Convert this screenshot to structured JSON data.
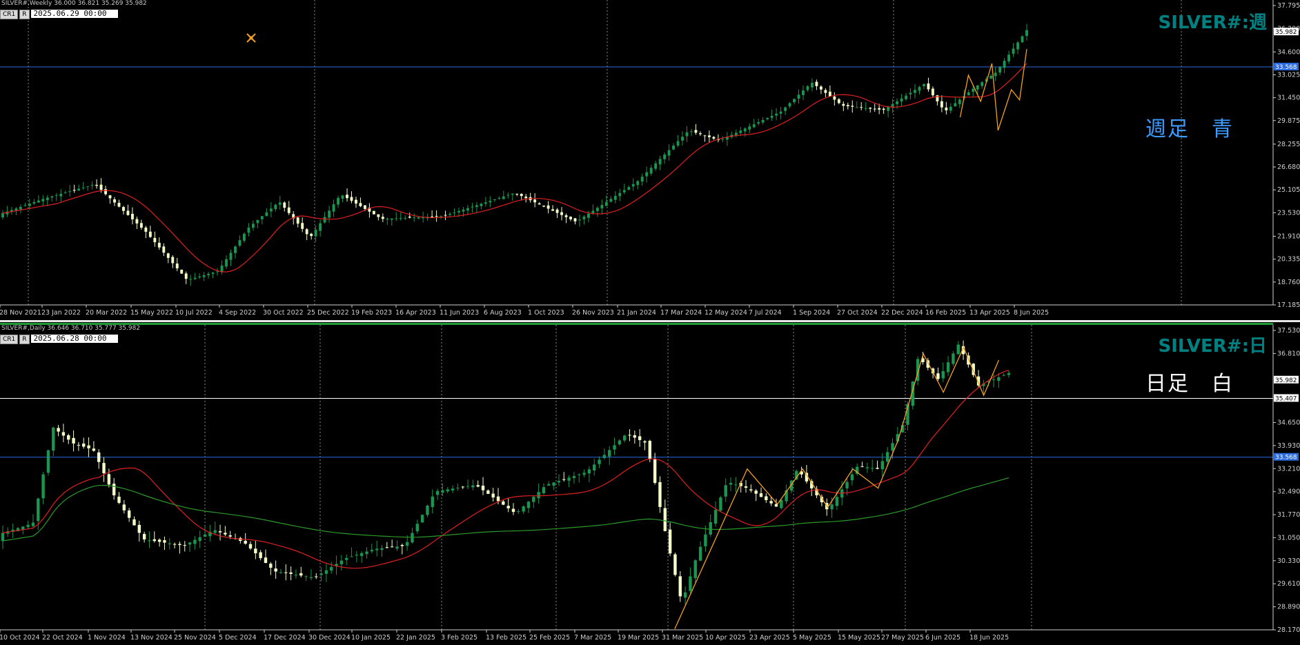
{
  "colors": {
    "bull": "#1a9650",
    "bear": "#f5ffc8",
    "ma_red": "#e02020",
    "ma_green": "#2a9a2a",
    "zigzag": "#f4a020",
    "hline_blue": "#2a6be0",
    "hline_white": "#ffffff",
    "symbol_teal": "#008080",
    "note_blue": "#3d9cff"
  },
  "weekly": {
    "info": "SILVER#,Weekly  36.000 36.821 35.269 35.982",
    "badges": [
      "CR1",
      "R"
    ],
    "date": "2025.06.29 00:00",
    "symbol_label": "SILVER#:週",
    "note": "週足　青",
    "cursor_icon": "crosshair-icon",
    "y_ticks": [
      "37.795",
      "36.200",
      "34.600",
      "33.025",
      "31.450",
      "29.875",
      "28.255",
      "26.680",
      "25.105",
      "23.530",
      "21.910",
      "20.335",
      "18.760",
      "17.185"
    ],
    "price_tags": {
      "current": "35.982",
      "blue_line": "33.568"
    },
    "x_ticks": [
      "28 Nov 2021",
      "23 Jan 2022",
      "20 Mar 2022",
      "15 May 2022",
      "10 Jul 2022",
      "4 Sep 2022",
      "30 Oct 2022",
      "25 Dec 2022",
      "19 Feb 2023",
      "16 Apr 2023",
      "11 Jun 2023",
      "6 Aug 2023",
      "1 Oct 2023",
      "26 Nov 2023",
      "21 Jan 2024",
      "17 Mar 2024",
      "12 May 2024",
      "7 Jul 2024",
      "1 Sep 2024",
      "27 Oct 2024",
      "22 Dec 2024",
      "16 Feb 2025",
      "13 Apr 2025",
      "8 Jun 2025"
    ]
  },
  "daily": {
    "info": "SILVER#,Daily  36.646 36.710 35.777 35.982",
    "badges": [
      "CR1",
      "R"
    ],
    "date": "2025.06.28 00:00",
    "symbol_label": "SILVER#:日",
    "note": "日足　白",
    "y_ticks": [
      "37.530",
      "36.810",
      "35.982",
      "35.407",
      "34.650",
      "33.930",
      "33.568",
      "33.210",
      "32.490",
      "31.770",
      "31.050",
      "30.330",
      "29.610",
      "28.890",
      "28.170"
    ],
    "price_tags": {
      "current": "35.982",
      "white_line": "35.407",
      "blue_line": "33.568"
    },
    "x_ticks": [
      "10 Oct 2024",
      "22 Oct 2024",
      "1 Nov 2024",
      "13 Nov 2024",
      "25 Nov 2024",
      "5 Dec 2024",
      "17 Dec 2024",
      "30 Dec 2024",
      "10 Jan 2025",
      "22 Jan 2025",
      "3 Feb 2025",
      "13 Feb 2025",
      "25 Feb 2025",
      "7 Mar 2025",
      "19 Mar 2025",
      "31 Mar 2025",
      "10 Apr 2025",
      "23 Apr 2025",
      "5 May 2025",
      "15 May 2025",
      "27 May 2025",
      "6 Jun 2025",
      "18 Jun 2025"
    ]
  }
}
